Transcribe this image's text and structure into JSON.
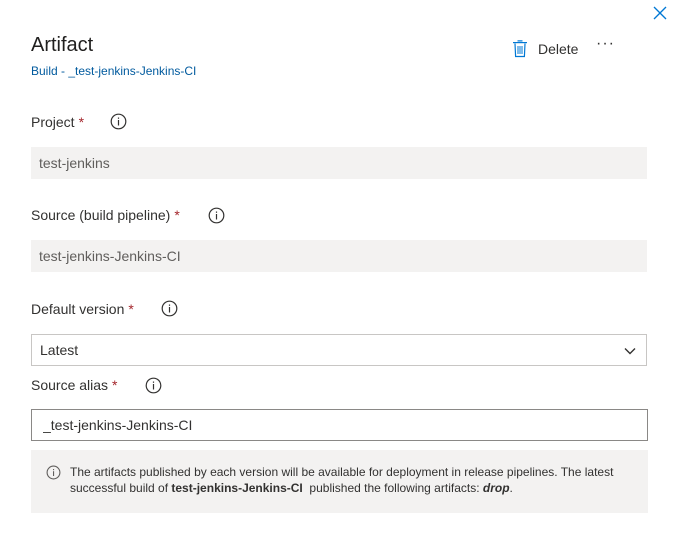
{
  "icons": {
    "close": "close-icon",
    "delete": "trash-icon",
    "more": "more-icon",
    "info": "info-icon",
    "dropdown": "chevron-down-icon"
  },
  "colors": {
    "link": "#005a9e",
    "required": "#a4262c",
    "readonly_background": "#f3f2f1",
    "close_icon": "#0078d4"
  },
  "header": {
    "title": "Artifact",
    "subtitle": "Build - _test-jenkins-Jenkins-CI",
    "delete_label": "Delete",
    "more_label": "···"
  },
  "form": {
    "project": {
      "label": "Project",
      "required_mark": "*",
      "value": "test-jenkins"
    },
    "source": {
      "label": "Source (build pipeline)",
      "required_mark": "*",
      "value": "test-jenkins-Jenkins-CI"
    },
    "default_version": {
      "label": "Default version",
      "required_mark": "*",
      "selected": "Latest"
    },
    "source_alias": {
      "label": "Source alias",
      "required_mark": "*",
      "value": "_test-jenkins-Jenkins-CI"
    }
  },
  "info_message": {
    "text_1": "The artifacts published by each version will be available for deployment in release pipelines. The latest successful build of ",
    "pipeline": "test-jenkins-Jenkins-CI",
    "text_2": "  published the following artifacts: ",
    "artifact": "drop",
    "text_3": "."
  }
}
